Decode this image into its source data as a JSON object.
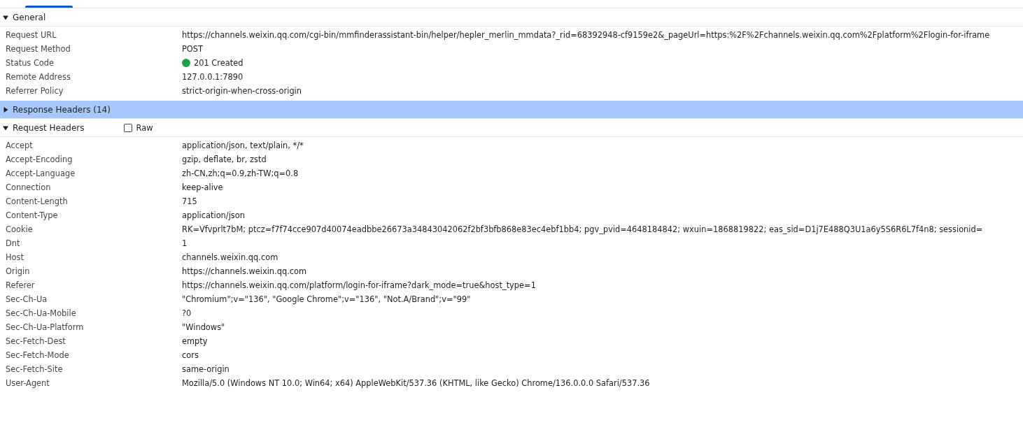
{
  "sections": [
    {
      "title": "General",
      "expanded": true,
      "selected": false,
      "rows": [
        {
          "name": "Request URL",
          "value": "https://channels.weixin.qq.com/cgi-bin/mmfinderassistant-bin/helper/hepler_merlin_mmdata?_rid=68392948-cf9159e2&_pageUrl=https:%2F%2Fchannels.weixin.qq.com%2Fplatform%2Flogin-for-iframe"
        },
        {
          "name": "Request Method",
          "value": "POST"
        },
        {
          "name": "Status Code",
          "value": "201 Created",
          "color": "#1ea446"
        },
        {
          "name": "Remote Address",
          "value": "127.0.0.1:7890"
        },
        {
          "name": "Referrer Policy",
          "value": "strict-origin-when-cross-origin"
        }
      ]
    },
    {
      "title": "Response Headers (14)",
      "expanded": false,
      "selected": true
    },
    {
      "title": "Request Headers",
      "expanded": true,
      "selected": false,
      "raw": {
        "label": "Raw",
        "checked": false
      },
      "rows": [
        {
          "name": "Accept",
          "value": "application/json, text/plain, */*"
        },
        {
          "name": "Accept-Encoding",
          "value": "gzip, deflate, br, zstd"
        },
        {
          "name": "Accept-Language",
          "value": "zh-CN,zh;q=0.9,zh-TW;q=0.8"
        },
        {
          "name": "Connection",
          "value": "keep-alive"
        },
        {
          "name": "Content-Length",
          "value": "715"
        },
        {
          "name": "Content-Type",
          "value": "application/json"
        },
        {
          "name": "Cookie",
          "value": "RK=Vfvprlt7bM; ptcz=f7f74cce907d40074eadbbe26673a34843042062f2bf3bfb868e83ec4ebf1bb4; pgv_pvid=4648184842; wxuin=1868819822; eas_sid=D1j7E488Q3U1a6y5S6R6L7f4n8; sessionid="
        },
        {
          "name": "Dnt",
          "value": "1"
        },
        {
          "name": "Host",
          "value": "channels.weixin.qq.com"
        },
        {
          "name": "Origin",
          "value": "https://channels.weixin.qq.com"
        },
        {
          "name": "Referer",
          "value": "https://channels.weixin.qq.com/platform/login-for-iframe?dark_mode=true&host_type=1"
        },
        {
          "name": "Sec-Ch-Ua",
          "value": "\"Chromium\";v=\"136\", \"Google Chrome\";v=\"136\", \"Not.A/Brand\";v=\"99\""
        },
        {
          "name": "Sec-Ch-Ua-Mobile",
          "value": "?0"
        },
        {
          "name": "Sec-Ch-Ua-Platform",
          "value": "\"Windows\""
        },
        {
          "name": "Sec-Fetch-Dest",
          "value": "empty"
        },
        {
          "name": "Sec-Fetch-Mode",
          "value": "cors"
        },
        {
          "name": "Sec-Fetch-Site",
          "value": "same-origin"
        },
        {
          "name": "User-Agent",
          "value": "Mozilla/5.0 (Windows NT 10.0; Win64; x64) AppleWebKit/537.36 (KHTML, like Gecko) Chrome/136.0.0.0 Safari/537.36"
        }
      ]
    }
  ]
}
